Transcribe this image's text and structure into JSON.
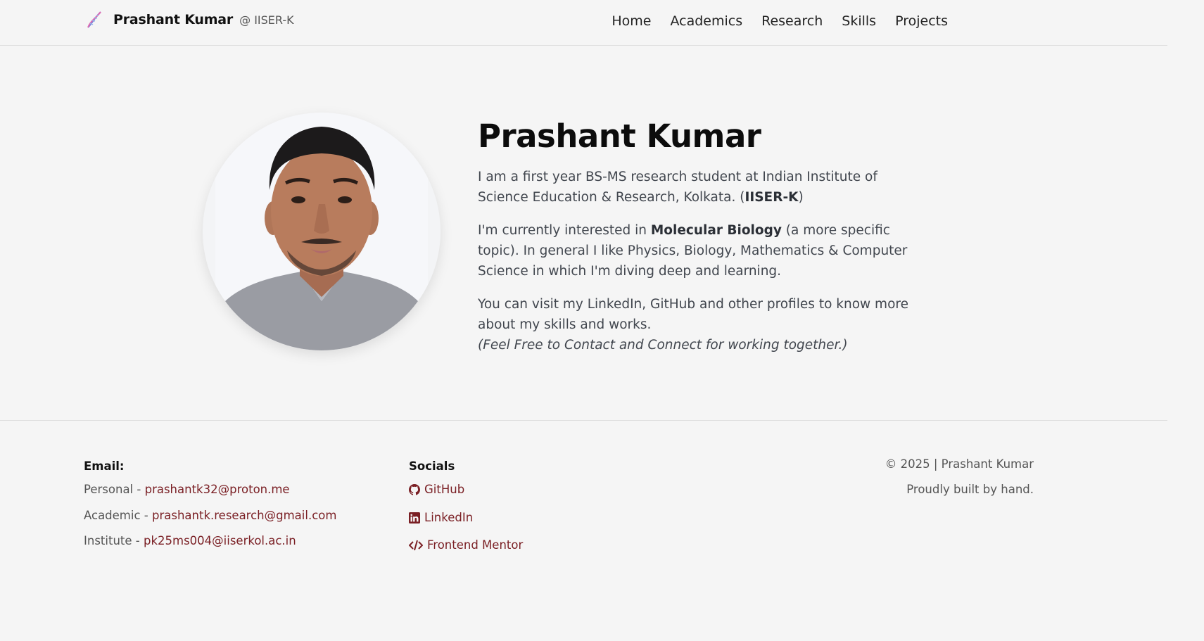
{
  "header": {
    "name": "Prashant Kumar",
    "affiliation": "@ IISER-K",
    "brand_icon": "dna-icon",
    "nav": [
      {
        "label": "Home"
      },
      {
        "label": "Academics"
      },
      {
        "label": "Research"
      },
      {
        "label": "Skills"
      },
      {
        "label": "Projects"
      }
    ]
  },
  "hero": {
    "title": "Prashant Kumar",
    "p1_text": "I am a first year BS-MS research student at Indian Institute of Science Education & Research, Kolkata. (",
    "p1_bold": "IISER-K",
    "p1_close": ")",
    "p2_text": "I'm currently interested in ",
    "p2_bold": "Molecular Biology",
    "p2_rest": " (a more specific topic). In general I like Physics, Biology, Mathematics & Computer Science in which I'm diving deep and learning.",
    "p3_text": "You can visit my LinkedIn, GitHub and other profiles to know more about my skills and works.",
    "p3_italic": "(Feel Free to Contact and Connect for working together.)"
  },
  "footer": {
    "email_heading": "Email:",
    "emails": [
      {
        "label": "Personal - ",
        "value": "prashantk32@proton.me"
      },
      {
        "label": "Academic - ",
        "value": "prashantk.research@gmail.com"
      },
      {
        "label": "Institute - ",
        "value": "pk25ms004@iiserkol.ac.in"
      }
    ],
    "socials_heading": "Socials",
    "socials": [
      {
        "icon": "github-icon",
        "label": "GitHub"
      },
      {
        "icon": "linkedin-icon",
        "label": "LinkedIn"
      },
      {
        "icon": "code-icon",
        "label": "Frontend Mentor"
      }
    ],
    "copyright": "© 2025 | Prashant Kumar",
    "tagline": "Proudly built by hand."
  },
  "colors": {
    "background": "#f5f5f5",
    "link": "#7a1f24",
    "text": "#41464e",
    "heading": "#0c0c0c"
  }
}
